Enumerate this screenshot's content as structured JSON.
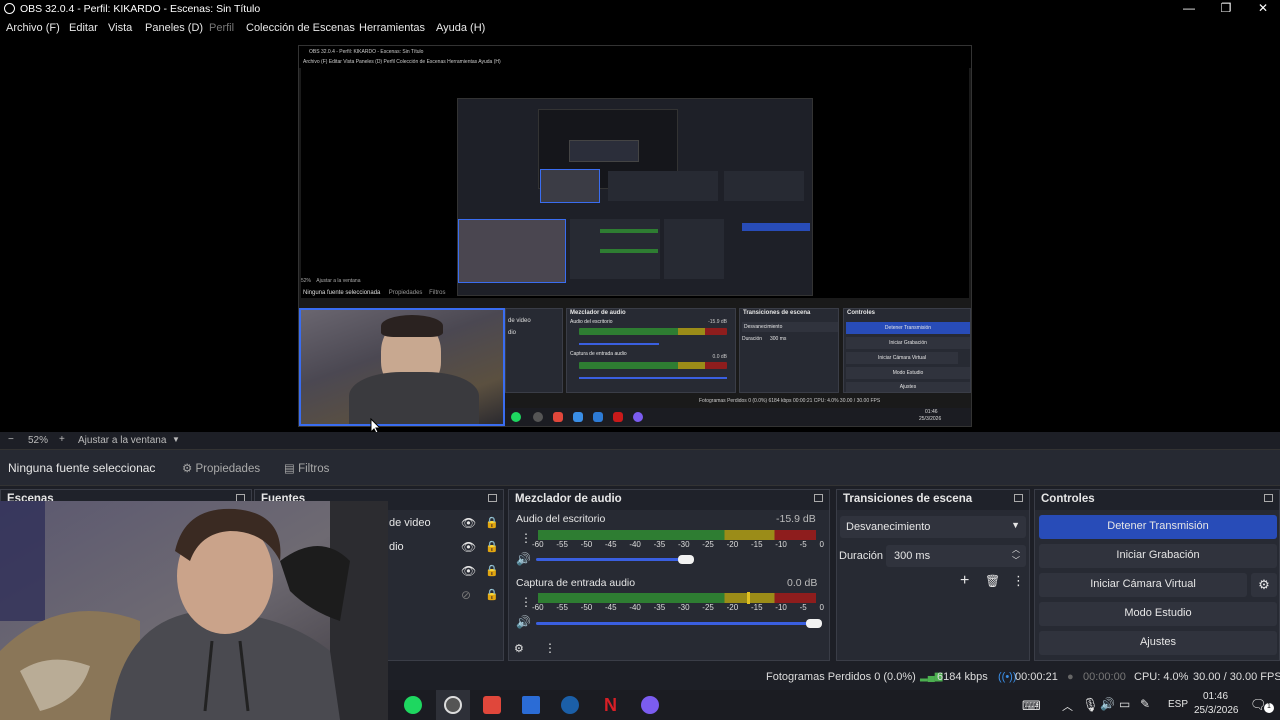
{
  "window": {
    "title": "OBS 32.0.4 - Perfil: KIKARDO - Escenas: Sin Título",
    "controls": [
      "—",
      "❐",
      "✕"
    ]
  },
  "menu": [
    {
      "label": "Archivo (F)",
      "enabled": true
    },
    {
      "label": "Editar",
      "enabled": true
    },
    {
      "label": "Vista",
      "enabled": true
    },
    {
      "label": "Paneles (D)",
      "enabled": true
    },
    {
      "label": "Perfil",
      "enabled": false
    },
    {
      "label": "Colección de Escenas",
      "enabled": true
    },
    {
      "label": "Herramientas",
      "enabled": true
    },
    {
      "label": "Ayuda (H)",
      "enabled": true
    }
  ],
  "nested": {
    "title": "OBS 32.0.4 - Perfil: KIKARDO - Escenas: Sin Título",
    "menu": "Archivo (F)    Editar    Vista    Paneles (D)    Perfil    Colección de Escenas    Herramientas    Ayuda (H)",
    "zoom": "52%",
    "fit": "Ajustar a la ventana",
    "no_source": "Ninguna fuente seleccionada",
    "properties": "Propiedades",
    "filters": "Filtros",
    "mixer_title": "Mezclador de audio",
    "transitions_title": "Transiciones de escena",
    "controls_title": "Controles",
    "desktop_audio": "Audio del escritorio",
    "mic_audio": "Captura de entrada audio",
    "transition": "Desvanecimiento",
    "duration_label": "Duración",
    "duration": "300 ms",
    "buttons": [
      "Detener Transmisión",
      "Iniciar Grabación",
      "Iniciar Cámara Virtual",
      "Modo Estudio",
      "Ajustes"
    ],
    "sources": [
      "de video",
      "dio"
    ],
    "status": "Fotogramas Perdidos 0 (0.0%)    6184 kbps    00:00:21    CPU: 4.0%    30.00 / 30.00 FPS",
    "desktop_db": "-15.9 dB",
    "mic_db": "0.0 dB",
    "clock": "01:46",
    "date": "25/3/2026"
  },
  "zoombar": {
    "minus": "−",
    "zoom": "52%",
    "plus": "+",
    "fit": "Ajustar a la ventana"
  },
  "sourcebar": {
    "no_source": "Ninguna fuente seleccionac",
    "properties": "Propiedades",
    "filters": "Filtros"
  },
  "docks": {
    "scenes": "Escenas",
    "sources": "Fuentes",
    "mixer": "Mezclador de audio",
    "transitions": "Transiciones de escena",
    "controls": "Controles"
  },
  "sources": [
    {
      "label": "de video",
      "visible": true,
      "locked": true
    },
    {
      "label": "dio",
      "visible": true,
      "locked": true
    },
    {
      "label": "",
      "visible": true,
      "locked": true
    },
    {
      "label": "",
      "visible": false,
      "locked": true
    }
  ],
  "mixer": {
    "channels": [
      {
        "name": "Audio del escritorio",
        "db": "-15.9 dB",
        "volume": 0.54
      },
      {
        "name": "Captura de entrada audio",
        "db": "0.0 dB",
        "volume": 1.0
      }
    ],
    "ticks": [
      "-60",
      "-55",
      "-50",
      "-45",
      "-40",
      "-35",
      "-30",
      "-25",
      "-20",
      "-15",
      "-10",
      "-5",
      "0"
    ]
  },
  "transitions": {
    "selected": "Desvanecimiento",
    "duration_label": "Duración",
    "duration": "300 ms"
  },
  "controls": {
    "stop_stream": "Detener Transmisión",
    "start_recording": "Iniciar Grabación",
    "start_virtual_cam": "Iniciar Cámara Virtual",
    "studio_mode": "Modo Estudio",
    "settings": "Ajustes"
  },
  "status": {
    "dropped": "Fotogramas Perdidos 0 (0.0%)",
    "bitrate": "6184 kbps",
    "stream_time": "00:00:21",
    "rec_time": "00:00:00",
    "cpu": "CPU: 4.0%",
    "fps": "30.00 / 30.00 FPS"
  },
  "taskbar": {
    "lang": "ESP",
    "time": "01:46",
    "date": "25/3/2026",
    "badge": "1"
  },
  "colors": {
    "accent": "#284cb8",
    "meter_green": "#2e7d32",
    "meter_yellow": "#9b8c18",
    "meter_red": "#8e1d1d"
  }
}
